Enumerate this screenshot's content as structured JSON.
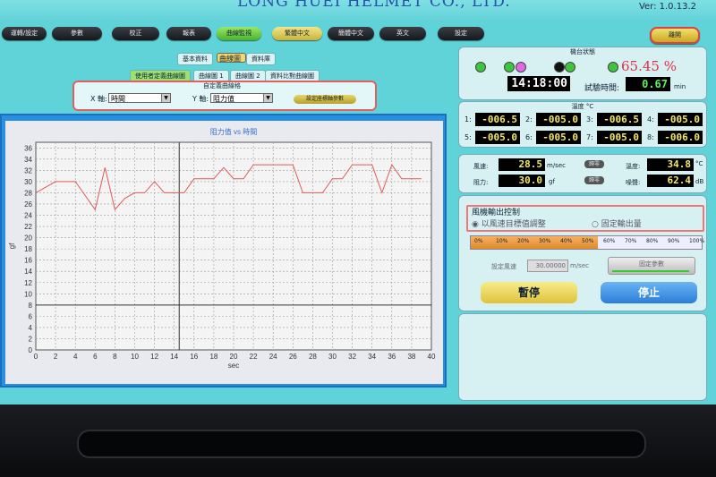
{
  "header": {
    "brand": "LONG HUEI HELMET CO., LTD.",
    "version": "Ver: 1.0.13.2"
  },
  "menu": [
    {
      "label": "運轉/設定",
      "style": "dark"
    },
    {
      "label": "參數",
      "style": "dark"
    },
    {
      "label": "校正",
      "style": "dark"
    },
    {
      "label": "報表",
      "style": "dark"
    },
    {
      "label": "曲線監視",
      "style": "green"
    },
    {
      "label": "繁體中文",
      "style": "yellow"
    },
    {
      "label": "簡體中文",
      "style": "dark"
    },
    {
      "label": "英文",
      "style": "dark"
    },
    {
      "label": "設定",
      "style": "dark"
    },
    {
      "label": "離開",
      "style": "exit"
    }
  ],
  "tabs": {
    "basic": "基本資料",
    "curve": "曲線圖",
    "data": "資料庫"
  },
  "subtabs": {
    "custom": "使用者定義曲線圖",
    "curve1": "曲線圖 1",
    "curve2": "曲線圖 2",
    "compare": "資料比對曲線圖"
  },
  "config": {
    "title": "自定義曲線格",
    "x_label": "X 軸:",
    "x_value": "時間",
    "y_label": "Y 軸:",
    "y_value": "阻力值",
    "set_button": "設定座標軸參數"
  },
  "chart_data": {
    "type": "line",
    "title": "阻力值 vs 時間",
    "xlabel": "sec",
    "ylabel": "gf",
    "xlim": [
      0,
      40
    ],
    "ylim": [
      0,
      37
    ],
    "xticks": [
      0,
      2,
      4,
      6,
      8,
      10,
      12,
      14,
      16,
      18,
      20,
      22,
      24,
      26,
      28,
      30,
      32,
      34,
      36,
      38,
      40
    ],
    "yticks": [
      0,
      2,
      4,
      6,
      8,
      10,
      12,
      14,
      16,
      18,
      20,
      22,
      24,
      26,
      28,
      30,
      32,
      34,
      36
    ],
    "grid": true,
    "series": [
      {
        "color": "#e05a5a",
        "x": [
          0,
          1,
          2,
          4,
          6,
          7,
          8,
          9,
          10,
          11,
          12,
          13,
          14,
          15,
          16,
          17,
          18,
          19,
          20,
          21,
          22,
          24,
          26,
          27,
          28,
          29,
          30,
          31,
          32,
          33,
          34,
          35,
          36,
          37,
          38,
          39
        ],
        "y": [
          28,
          29,
          30,
          30,
          25,
          32.5,
          25,
          27,
          28,
          28,
          30,
          28,
          28,
          28,
          30.5,
          30.5,
          30.5,
          32.5,
          30.5,
          30.5,
          33,
          33,
          33,
          28,
          28,
          28,
          30.5,
          30.5,
          33,
          33,
          33,
          28,
          33,
          30.5,
          30.5,
          30.5
        ]
      }
    ],
    "hline": 8,
    "vline": 14.5
  },
  "status": {
    "title": "機台狀態",
    "percent": "65.45 %",
    "lamps": [
      "#3fc43f",
      "#3fc43f",
      "#e06adf",
      "#111111",
      "#3fc43f",
      "#3fc43f"
    ],
    "clock": "14:18:00",
    "test_time_label": "試驗時間:",
    "test_time": "0.67",
    "test_time_unit": "min"
  },
  "temperature": {
    "title": "溫度 °C",
    "sensors": [
      {
        "label": "1:",
        "value": "-006.5"
      },
      {
        "label": "2:",
        "value": "-005.0"
      },
      {
        "label": "3:",
        "value": "-006.5"
      },
      {
        "label": "4:",
        "value": "-005.0"
      },
      {
        "label": "5:",
        "value": "-005.0"
      },
      {
        "label": "6:",
        "value": "-005.0"
      },
      {
        "label": "7:",
        "value": "-005.0"
      },
      {
        "label": "8:",
        "value": "-006.0"
      }
    ]
  },
  "measure": {
    "wind_label": "風速:",
    "wind_value": "28.5",
    "wind_unit": "m/sec",
    "resist_label": "阻力:",
    "resist_value": "30.0",
    "resist_unit": "gf",
    "temp_label": "溫度:",
    "temp_value": "34.8",
    "temp_unit": "°C",
    "noise_label": "噪聲:",
    "noise_value": "62.4",
    "noise_unit": "dB",
    "tare_label": "歸零"
  },
  "fan": {
    "title": "風機輸出控制",
    "option1": "以風速目標值調整",
    "option2": "固定輸出量",
    "scale": [
      "0%",
      "10%",
      "20%",
      "30%",
      "40%",
      "50%",
      "60%",
      "70%",
      "80%",
      "90%",
      "100%"
    ],
    "output_fraction": 0.55,
    "setpoint_label": "設定風速",
    "setpoint_value": "30.00000",
    "setpoint_unit": "m/sec",
    "fixed_button": "固定參數",
    "pause_button": "暫停",
    "stop_button": "停止"
  }
}
